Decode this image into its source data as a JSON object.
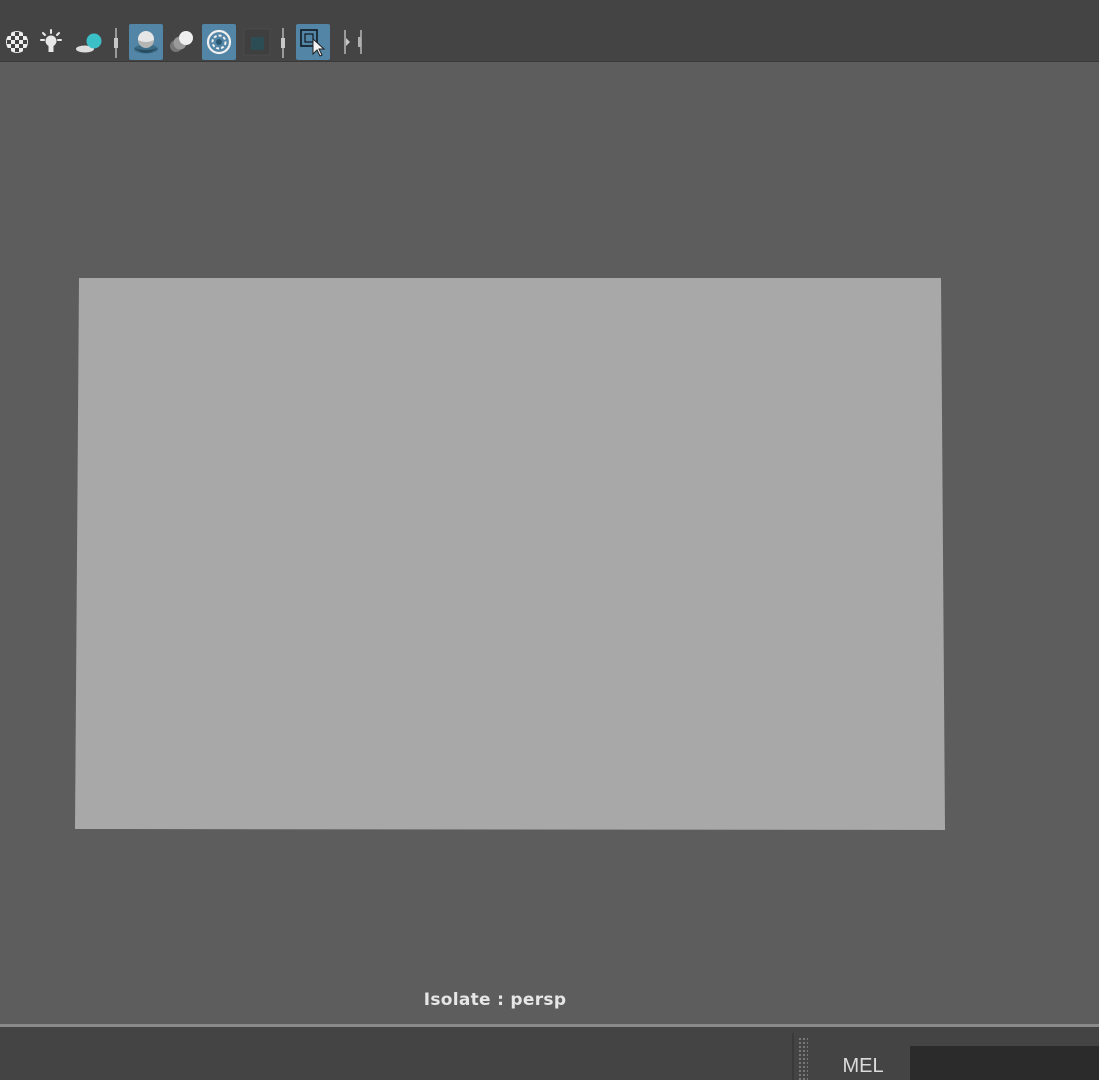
{
  "toolbar": {
    "icons": [
      {
        "name": "checker-icon",
        "active": false
      },
      {
        "name": "light-bulb-icon",
        "active": false
      },
      {
        "name": "shadow-sphere-icon",
        "active": false
      },
      {
        "name": "separator"
      },
      {
        "name": "ambient-occlusion-icon",
        "active": true
      },
      {
        "name": "motion-blur-icon",
        "active": false
      },
      {
        "name": "anti-aliasing-icon",
        "active": true
      },
      {
        "name": "textured-square-icon",
        "active": false
      },
      {
        "name": "separator"
      },
      {
        "name": "isolate-select-icon",
        "active": true
      },
      {
        "name": "expand-arrow-icon",
        "active": false
      }
    ]
  },
  "viewport": {
    "camera_label": "Isolate : persp",
    "plane_color": "#a8a8a8",
    "background_color": "#5d5d5d"
  },
  "command_line": {
    "language_label": "MEL",
    "input_value": "",
    "input_placeholder": ""
  },
  "colors": {
    "accent": "#5285a6",
    "toolbar_bg": "#444444",
    "cyan": "#3cc0c8"
  }
}
